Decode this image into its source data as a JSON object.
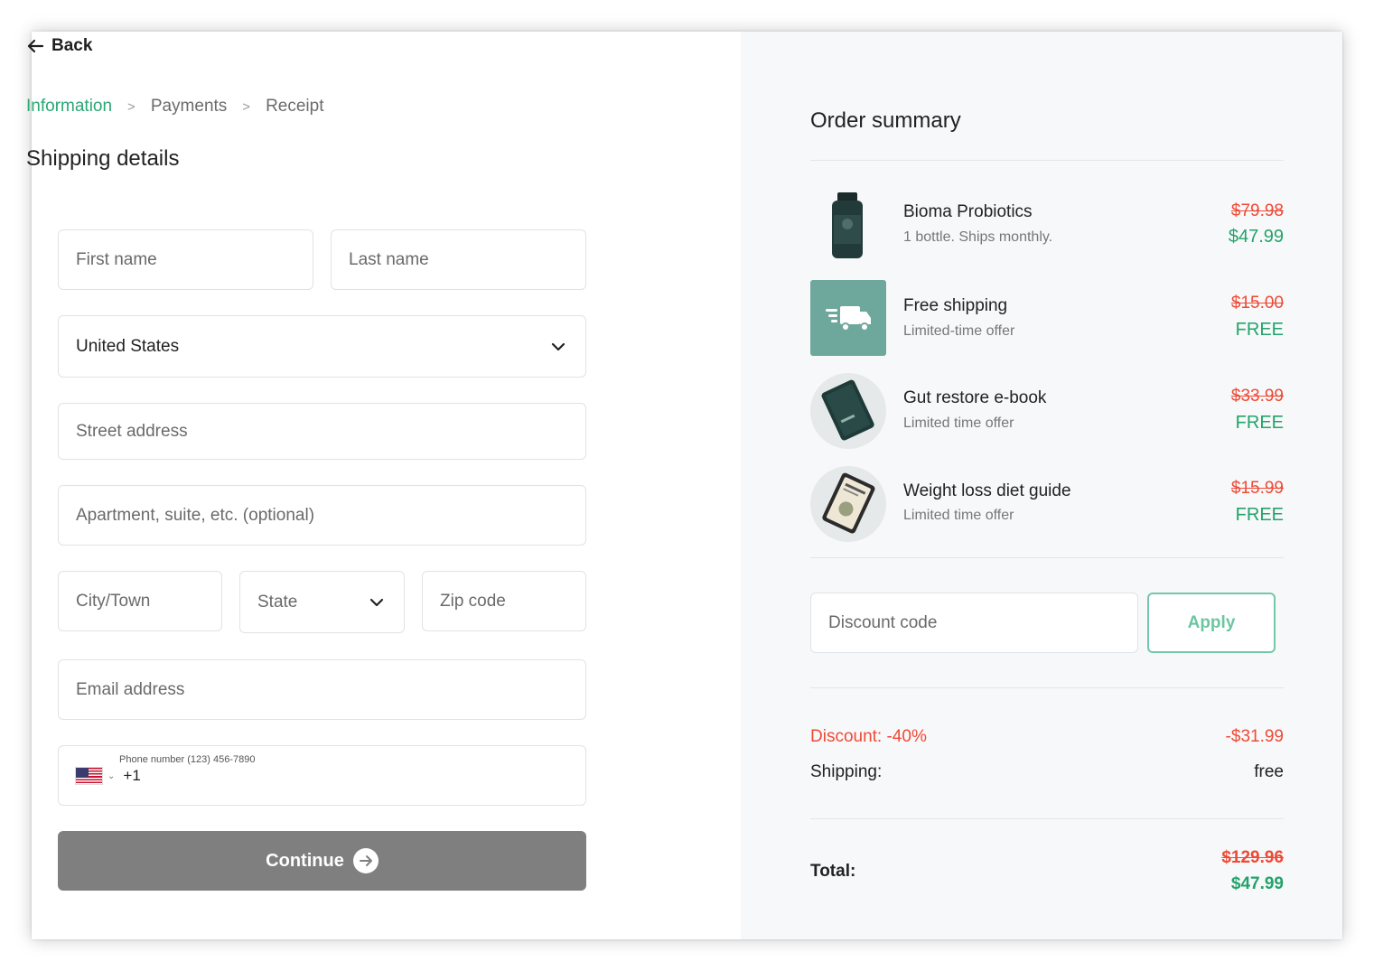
{
  "nav": {
    "back_label": "Back"
  },
  "breadcrumb": {
    "steps": [
      "Information",
      "Payments",
      "Receipt"
    ],
    "active": "Information",
    "separator": ">"
  },
  "shipping": {
    "title": "Shipping details",
    "first_name_placeholder": "First name",
    "last_name_placeholder": "Last name",
    "country_value": "United States",
    "street_placeholder": "Street address",
    "apartment_placeholder": "Apartment, suite, etc. (optional)",
    "city_placeholder": "City/Town",
    "state_placeholder": "State",
    "zip_placeholder": "Zip code",
    "email_placeholder": "Email address",
    "phone_label": "Phone number (123) 456-7890",
    "phone_country_icon": "us-flag-icon",
    "phone_prefix": "+1",
    "continue_label": "Continue"
  },
  "order": {
    "title": "Order summary",
    "items": [
      {
        "name": "Bioma Probiotics",
        "subtitle": "1 bottle. Ships monthly.",
        "old_price": "$79.98",
        "new_price": "$47.99",
        "image": "probiotics-bottle-image"
      },
      {
        "name": "Free shipping",
        "subtitle": "Limited-time offer",
        "old_price": "$15.00",
        "new_price": "FREE",
        "image": "delivery-truck-icon"
      },
      {
        "name": "Gut restore e-book",
        "subtitle": "Limited time offer",
        "old_price": "$33.99",
        "new_price": "FREE",
        "image": "ebook-tablet-image"
      },
      {
        "name": "Weight loss diet guide",
        "subtitle": "Limited time offer",
        "old_price": "$15.99",
        "new_price": "FREE",
        "image": "diet-guide-tablet-image"
      }
    ],
    "discount_placeholder": "Discount code",
    "apply_label": "Apply",
    "discount_label": "Discount: -40%",
    "discount_value": "-$31.99",
    "shipping_label": "Shipping:",
    "shipping_value": "free",
    "total_label": "Total:",
    "total_old": "$129.96",
    "total_new": "$47.99"
  },
  "colors": {
    "accent_green": "#23a36a",
    "strike_red": "#ef4a36",
    "button_gray": "#7f7f7f",
    "panel_bg": "#f7f8f9",
    "truck_tile": "#6ea89d"
  }
}
